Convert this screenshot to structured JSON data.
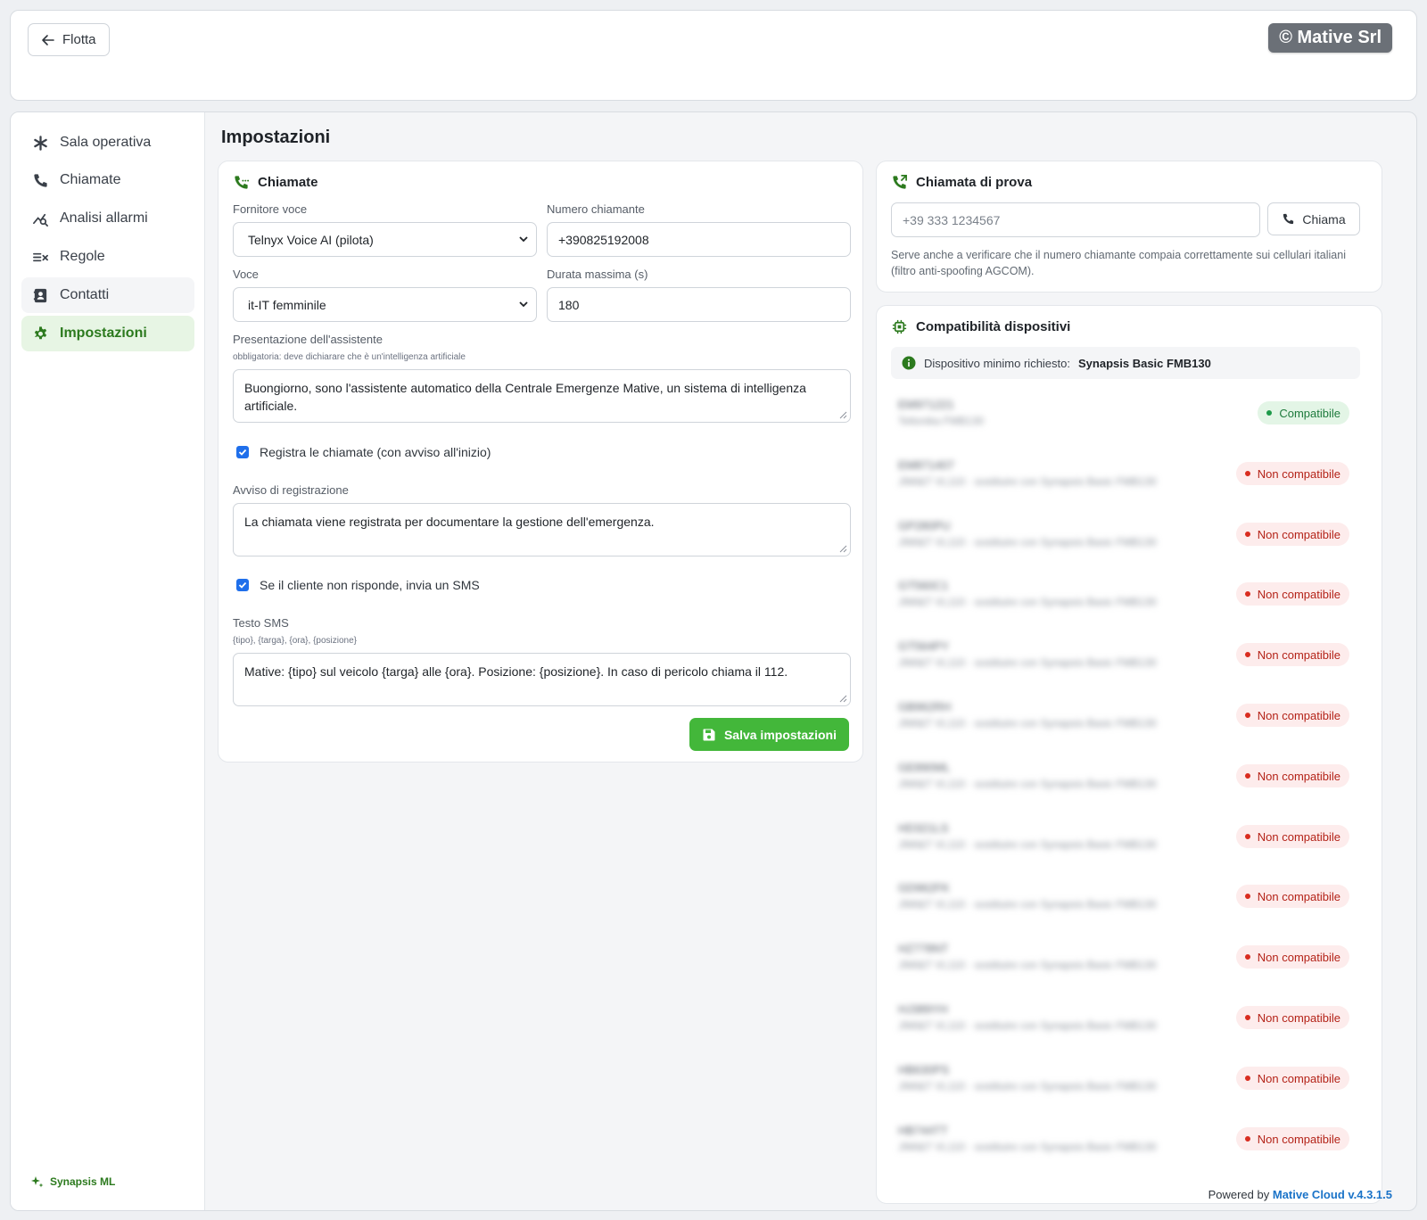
{
  "topbar": {
    "back_label": "Flotta",
    "brand": "© Mative Srl"
  },
  "sidebar": {
    "items": [
      {
        "label": "Sala operativa",
        "icon": "asterisk-icon"
      },
      {
        "label": "Chiamate",
        "icon": "phone-icon"
      },
      {
        "label": "Analisi allarmi",
        "icon": "chart-search-icon"
      },
      {
        "label": "Regole",
        "icon": "rules-icon"
      },
      {
        "label": "Contatti",
        "icon": "contact-card-icon"
      },
      {
        "label": "Impostazioni",
        "icon": "gear-icon"
      }
    ],
    "active": "Impostazioni",
    "footer": "Synapsis ML"
  },
  "page": {
    "title": "Impostazioni"
  },
  "calls": {
    "title": "Chiamate",
    "provider_label": "Fornitore voce",
    "provider_value": "Telnyx Voice AI (pilota)",
    "caller_label": "Numero chiamante",
    "caller_value": "+390825192008",
    "voice_label": "Voce",
    "voice_value": "it-IT femminile",
    "duration_label": "Durata massima (s)",
    "duration_value": "180",
    "intro_label": "Presentazione dell'assistente",
    "intro_hint": "obbligatoria: deve dichiarare che è un'intelligenza artificiale",
    "intro_value": "Buongiorno, sono l'assistente automatico della Centrale Emergenze Mative, un sistema di intelligenza artificiale.",
    "record_label": "Registra le chiamate (con avviso all'inizio)",
    "record_checked": true,
    "notice_label": "Avviso di registrazione",
    "notice_value": "La chiamata viene registrata per documentare la gestione dell'emergenza.",
    "sms_check_label": "Se il cliente non risponde, invia un SMS",
    "sms_checked": true,
    "sms_label": "Testo SMS",
    "sms_hint": "{tipo}, {targa}, {ora}, {posizione}",
    "sms_value": "Mative: {tipo} sul veicolo {targa} alle {ora}. Posizione: {posizione}. In caso di pericolo chiama il 112.",
    "save_label": "Salva impostazioni"
  },
  "test_call": {
    "title": "Chiamata di prova",
    "placeholder": "+39 333 1234567",
    "button": "Chiama",
    "note": "Serve anche a verificare che il numero chiamante compaia correttamente sui cellulari italiani (filtro anti-spoofing AGCOM)."
  },
  "compat": {
    "title": "Compatibilità dispositivi",
    "min_label": "Dispositivo minimo richiesto:",
    "min_value": "Synapsis Basic FMB130",
    "devices": [
      {
        "id": "EM971221",
        "sub": "Teltonika FMB130",
        "status": "Compatibile"
      },
      {
        "id": "EM871407",
        "sub": "JIMI&T VL110 · sostituire con Synapsis Basic FMB130",
        "status": "Non compatibile"
      },
      {
        "id": "GP280PU",
        "sub": "JIMI&T VL110 · sostituire con Synapsis Basic FMB130",
        "status": "Non compatibile"
      },
      {
        "id": "GT560C1",
        "sub": "JIMI&T VL110 · sostituire con Synapsis Basic FMB130",
        "status": "Non compatibile"
      },
      {
        "id": "GT564PY",
        "sub": "JIMI&T VL110 · sostituire con Synapsis Basic FMB130",
        "status": "Non compatibile"
      },
      {
        "id": "GB962RH",
        "sub": "JIMI&T VL110 · sostituire con Synapsis Basic FMB130",
        "status": "Non compatibile"
      },
      {
        "id": "GE890ML",
        "sub": "JIMI&T VL110 · sostituire con Synapsis Basic FMB130",
        "status": "Non compatibile"
      },
      {
        "id": "HD321LS",
        "sub": "JIMI&T VL110 · sostituire con Synapsis Basic FMB130",
        "status": "Non compatibile"
      },
      {
        "id": "GD962FK",
        "sub": "JIMI&T VL110 · sostituire con Synapsis Basic FMB130",
        "status": "Non compatibile"
      },
      {
        "id": "HZ778NT",
        "sub": "JIMI&T VL110 · sostituire con Synapsis Basic FMB130",
        "status": "Non compatibile"
      },
      {
        "id": "HJ389YH",
        "sub": "JIMI&T VL110 · sostituire con Synapsis Basic FMB130",
        "status": "Non compatibile"
      },
      {
        "id": "HB630PS",
        "sub": "JIMI&T VL110 · sostituire con Synapsis Basic FMB130",
        "status": "Non compatibile"
      },
      {
        "id": "HB744TT",
        "sub": "JIMI&T VL110 · sostituire con Synapsis Basic FMB130",
        "status": "Non compatibile"
      }
    ]
  },
  "footer": {
    "prefix": "Powered by",
    "product": "Mative Cloud v.4.3.1.5"
  },
  "colors": {
    "accent": "#43b73a",
    "active_nav_bg": "#e7f5e4",
    "active_nav_text": "#2c7a1e",
    "danger": "#b42318",
    "success": "#1d7a3c",
    "link": "#1a73c8"
  }
}
